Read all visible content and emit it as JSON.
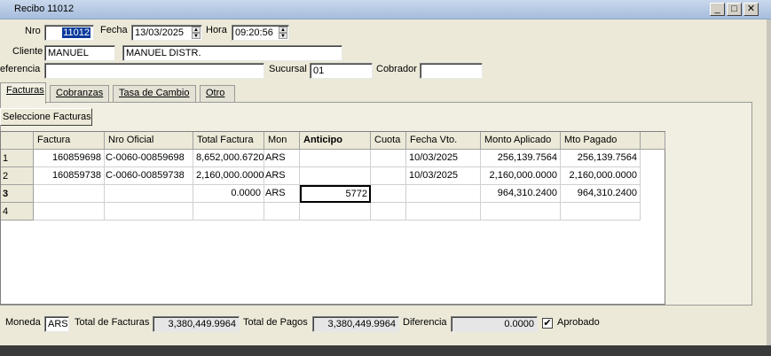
{
  "window": {
    "title": "Recibo 11012",
    "minimize": "_",
    "maximize": "□",
    "close": "✕"
  },
  "header": {
    "nro_label": "Nro",
    "nro_value": "11012",
    "fecha_label": "Fecha",
    "fecha_value": "13/03/2025",
    "hora_label": "Hora",
    "hora_value": "09:20:56",
    "cliente_label": "Cliente",
    "cliente_code": "MANUEL",
    "cliente_name": "MANUEL DISTR.",
    "referencia_label": "eferencia",
    "referencia_value": "",
    "sucursal_label": "Sucursal",
    "sucursal_value": "01",
    "cobrador_label": "Cobrador",
    "cobrador_value": ""
  },
  "tabs": [
    {
      "label": "Facturas"
    },
    {
      "label": "Cobranzas"
    },
    {
      "label": "Tasa de Cambio"
    },
    {
      "label": "Otro"
    }
  ],
  "select_button": "Seleccione Facturas",
  "grid": {
    "columns": [
      "Factura",
      "Nro Oficial",
      "Total Factura",
      "Mon",
      "Anticipo",
      "Cuota",
      "Fecha Vto.",
      "Monto Aplicado",
      "Mto Pagado"
    ],
    "row_numbers": [
      "1",
      "2",
      "3",
      "4"
    ],
    "rows": [
      {
        "factura": "160859698",
        "nro_oficial": "C-0060-00859698",
        "total": "8,652,000.6720",
        "mon": "ARS",
        "anticipo": "",
        "cuota": "",
        "vto": "10/03/2025",
        "aplicado": "256,139.7564",
        "pagado": "256,139.7564"
      },
      {
        "factura": "160859738",
        "nro_oficial": "C-0060-00859738",
        "total": "2,160,000.0000",
        "mon": "ARS",
        "anticipo": "",
        "cuota": "",
        "vto": "10/03/2025",
        "aplicado": "2,160,000.0000",
        "pagado": "2,160,000.0000"
      },
      {
        "factura": "",
        "nro_oficial": "",
        "total": "0.0000",
        "mon": "ARS",
        "anticipo": "5772",
        "cuota": "",
        "vto": "",
        "aplicado": "964,310.2400",
        "pagado": "964,310.2400"
      },
      {
        "factura": "",
        "nro_oficial": "",
        "total": "",
        "mon": "",
        "anticipo": "",
        "cuota": "",
        "vto": "",
        "aplicado": "",
        "pagado": ""
      }
    ]
  },
  "footer": {
    "moneda_label": "Moneda",
    "moneda_value": "ARS",
    "total_facturas_label": "Total de Facturas",
    "total_facturas_value": "3,380,449.9964",
    "total_pagos_label": "Total de Pagos",
    "total_pagos_value": "3,380,449.9964",
    "diferencia_label": "Diferencia",
    "diferencia_value": "0.0000",
    "aprobado_label": "Aprobado",
    "aprobado_check": "✔"
  }
}
